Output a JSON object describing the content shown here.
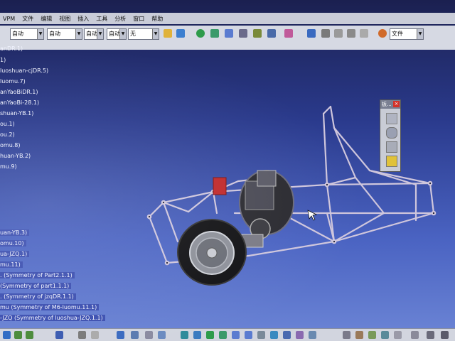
{
  "menu": {
    "items": [
      "VPM",
      "文件",
      "编辑",
      "视图",
      "插入",
      "工具",
      "分析",
      "窗口",
      "帮助"
    ]
  },
  "toolbar": {
    "combo_1": "自动",
    "combo_2": "自动",
    "combo_3": "自动",
    "combo_4": "自动",
    "combo_5": "无",
    "file_combo": "文件"
  },
  "tree": {
    "items": [
      {
        "label": "anDR.1)"
      },
      {
        "label": "1)"
      },
      {
        "label": "luoshuan-cjDR.5)"
      },
      {
        "label": "luomu.7)"
      },
      {
        "label": "anYaoBiDR.1)"
      },
      {
        "label": "anYaoBi-28.1)"
      },
      {
        "label": "shuan-YB.1)"
      },
      {
        "label": "ou.1)"
      },
      {
        "label": "ou.2)"
      },
      {
        "label": "omu.8)"
      },
      {
        "label": "huan-YB.2)"
      },
      {
        "label": "mu.9)"
      },
      {
        "label": "uan-YB.3)"
      },
      {
        "label": "omu.10)"
      },
      {
        "label": "ua-JZQ.1)"
      },
      {
        "label": "mu.11)"
      },
      {
        "label": ". (Symmetry of Part2.1.1)"
      },
      {
        "label": "(Symmetry of part1.1.1)"
      },
      {
        "label": ". (Symmetry of jzqDR.1.1)"
      },
      {
        "label": "mu (Symmetry of M6-luomu.11.1)"
      },
      {
        "label": "-JZQ (Symmetry of luoshua-JZQ.1.1)"
      }
    ]
  },
  "palette": {
    "title": "板..."
  }
}
